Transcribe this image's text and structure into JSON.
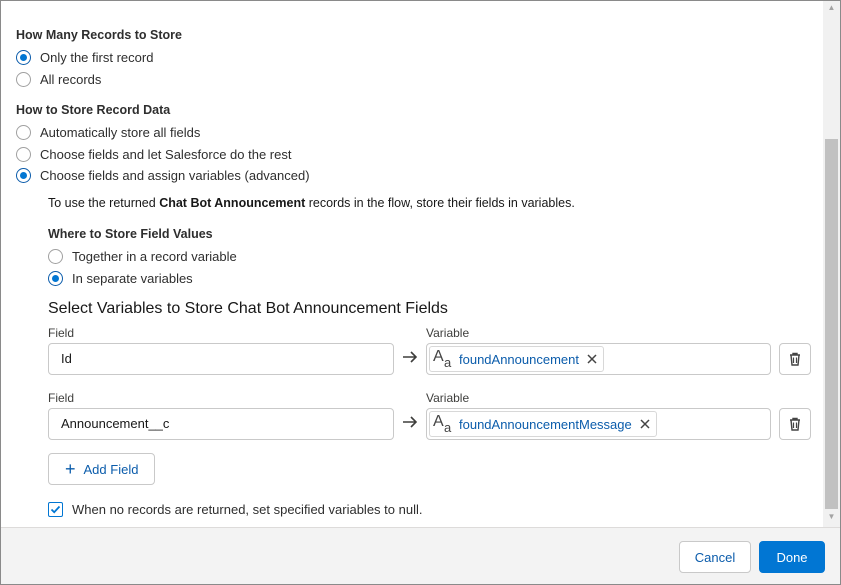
{
  "records_section": {
    "title": "How Many Records to Store",
    "options": [
      {
        "label": "Only the first record",
        "checked": true
      },
      {
        "label": "All records",
        "checked": false
      }
    ]
  },
  "store_section": {
    "title": "How to Store Record Data",
    "options": [
      {
        "label": "Automatically store all fields",
        "checked": false
      },
      {
        "label": "Choose fields and let Salesforce do the rest",
        "checked": false
      },
      {
        "label": "Choose fields and assign variables (advanced)",
        "checked": true
      }
    ]
  },
  "info": {
    "prefix": "To use the returned ",
    "object_name": "Chat Bot Announcement",
    "suffix": " records in the flow, store their fields in variables."
  },
  "where_section": {
    "title": "Where to Store Field Values",
    "options": [
      {
        "label": "Together in a record variable",
        "checked": false
      },
      {
        "label": "In separate variables",
        "checked": true
      }
    ]
  },
  "mapping": {
    "heading": "Select Variables to Store Chat Bot Announcement Fields",
    "field_label": "Field",
    "variable_label": "Variable",
    "rows": [
      {
        "field": "Id",
        "variable": "foundAnnouncement"
      },
      {
        "field": "Announcement__c",
        "variable": "foundAnnouncementMessage"
      }
    ],
    "add_field_label": "Add Field"
  },
  "null_option": {
    "label": "When no records are returned, set specified variables to null.",
    "checked": true
  },
  "footer": {
    "cancel_label": "Cancel",
    "done_label": "Done"
  },
  "icons": {
    "arrow": "arrow-right-icon",
    "text_type": "text-type-icon",
    "remove": "close-icon",
    "delete": "trash-icon",
    "add": "plus-icon",
    "checkbox": "checkmark-icon"
  },
  "colors": {
    "brand": "#0176d3",
    "link": "#0b5cab"
  }
}
